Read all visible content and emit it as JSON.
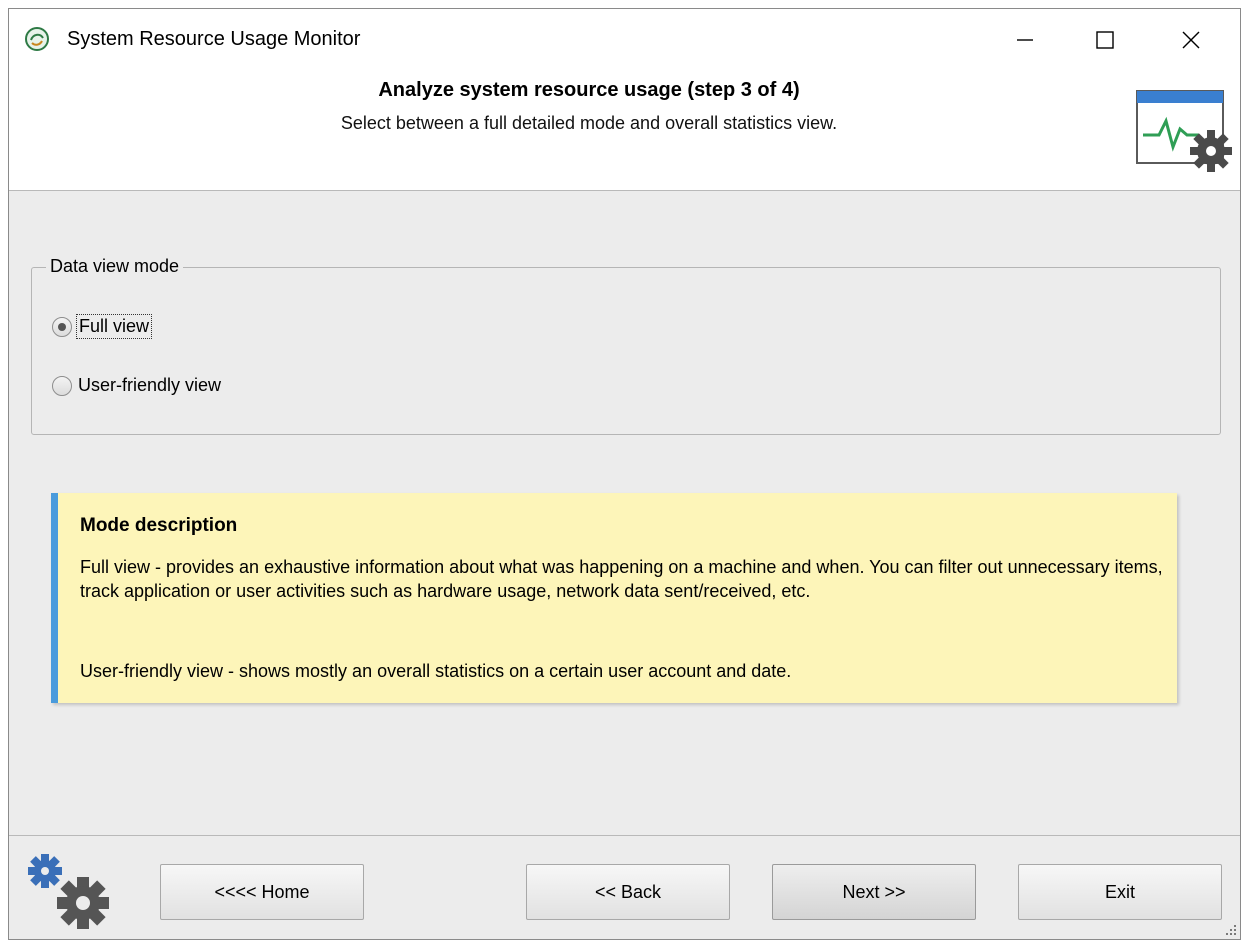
{
  "window": {
    "title": "System Resource Usage Monitor",
    "minimize_glyph": "—",
    "maximize_glyph": "☐",
    "close_glyph": "✕"
  },
  "header": {
    "title": "Analyze system resource usage (step 3 of 4)",
    "subtitle": "Select between a full detailed mode and overall statistics view.",
    "icon": "monitor-gear-icon"
  },
  "view_mode": {
    "legend": "Data view mode",
    "options": [
      {
        "label": "Full view",
        "checked": true
      },
      {
        "label": "User-friendly view",
        "checked": false
      }
    ]
  },
  "description": {
    "title": "Mode description",
    "full": "Full view - provides an exhaustive information about what was happening on a machine and when. You can filter out unnecessary items, track application or user activities such as hardware usage, network data sent/received, etc.",
    "user": "User-friendly view - shows mostly an overall statistics on a certain user account and date."
  },
  "footer": {
    "home": "<<<< Home",
    "back": "<< Back",
    "next": "Next >>",
    "exit": "Exit"
  },
  "colors": {
    "accent_bar": "#4a9bdc",
    "note_bg": "#fdf5b9",
    "window_bg": "#ececec"
  }
}
